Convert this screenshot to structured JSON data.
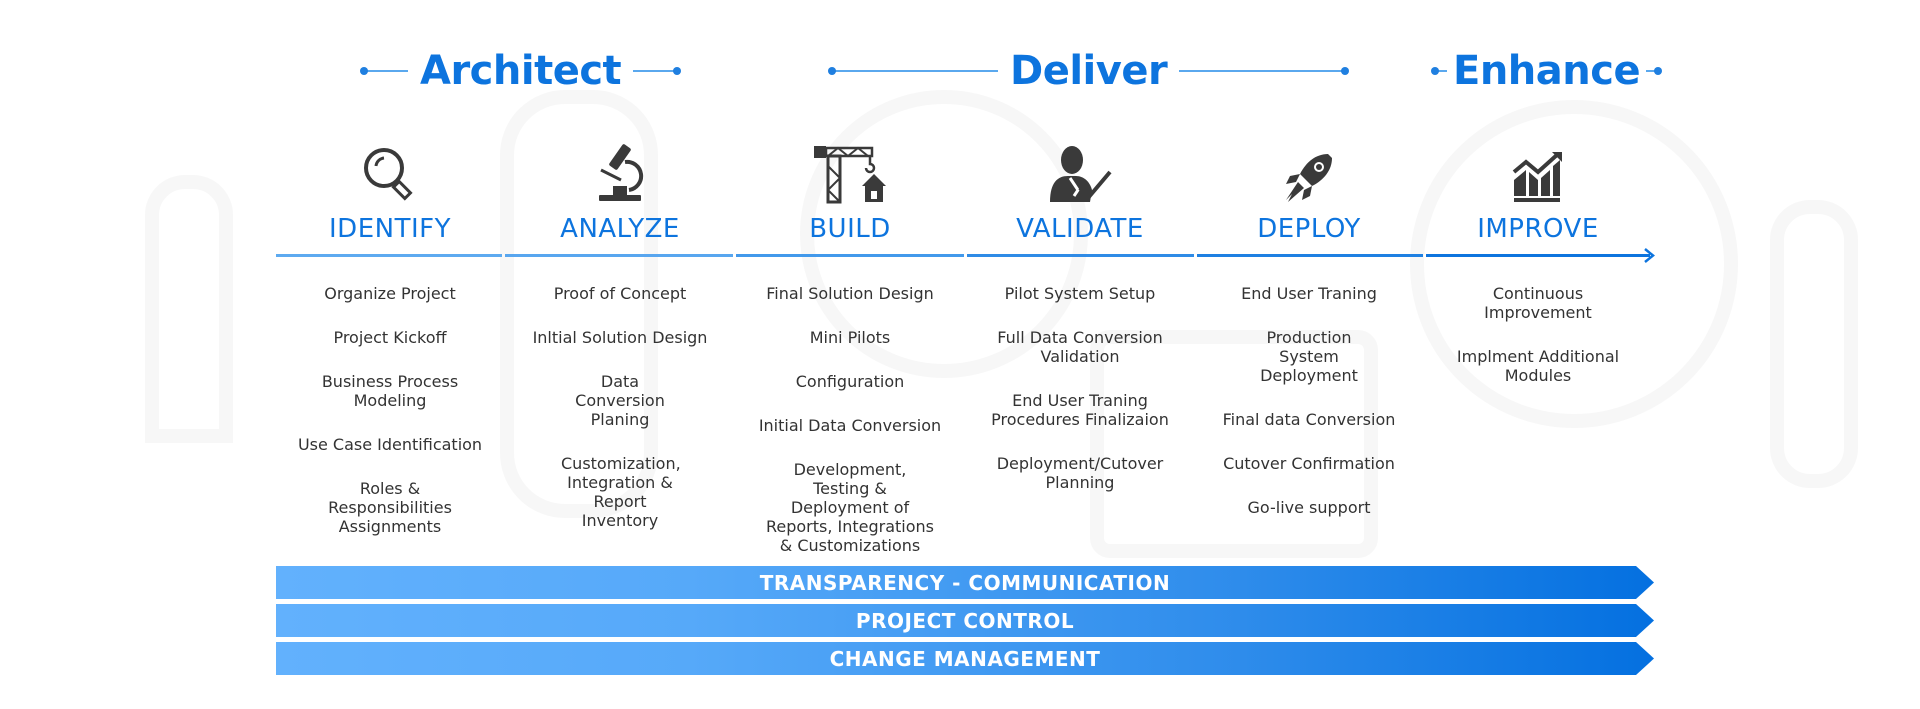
{
  "phases": [
    {
      "title": "Architect"
    },
    {
      "title": "Deliver"
    },
    {
      "title": "Enhance"
    }
  ],
  "colors": {
    "accent": "#0d74de",
    "text": "#333333",
    "line_light": "#5aa8ee",
    "band_start": "#62b1fd",
    "band_end": "#0470e0"
  },
  "stages": [
    {
      "name": "IDENTIFY",
      "icon": "magnifier-icon",
      "tasks": [
        "Organize Project",
        "Project Kickoff",
        "Business Process Modeling",
        "Use Case Identification",
        "Roles & Responsibilities Assignments"
      ]
    },
    {
      "name": "ANALYZE",
      "icon": "microscope-icon",
      "tasks": [
        "Proof of Concept",
        "Inltial Solution Design",
        "Data Conversion Planing",
        "Customization, Integration & Report Inventory"
      ]
    },
    {
      "name": "BUILD",
      "icon": "crane-house-icon",
      "tasks": [
        "Final Solution Design",
        "Mini Pilots",
        "Configuration",
        "Initial Data Conversion",
        "Development, Testing & Deployment of Reports, Integrations & Customizations"
      ]
    },
    {
      "name": "VALIDATE",
      "icon": "person-check-icon",
      "tasks": [
        "Pilot System Setup",
        "Full Data Conversion Validation",
        "End User Traning Procedures Finalizaion",
        "Deployment/Cutover Planning"
      ]
    },
    {
      "name": "DEPLOY",
      "icon": "rocket-icon",
      "tasks": [
        "End User Traning",
        "Production System Deployment",
        "Final data Conversion",
        "Cutover Confirmation",
        "Go-live support"
      ]
    },
    {
      "name": "IMPROVE",
      "icon": "growth-chart-icon",
      "tasks": [
        "Continuous Improvement",
        "Implment Additional Modules"
      ]
    }
  ],
  "bands": [
    "TRANSPARENCY - COMMUNICATION",
    "PROJECT CONTROL",
    "CHANGE MANAGEMENT"
  ]
}
